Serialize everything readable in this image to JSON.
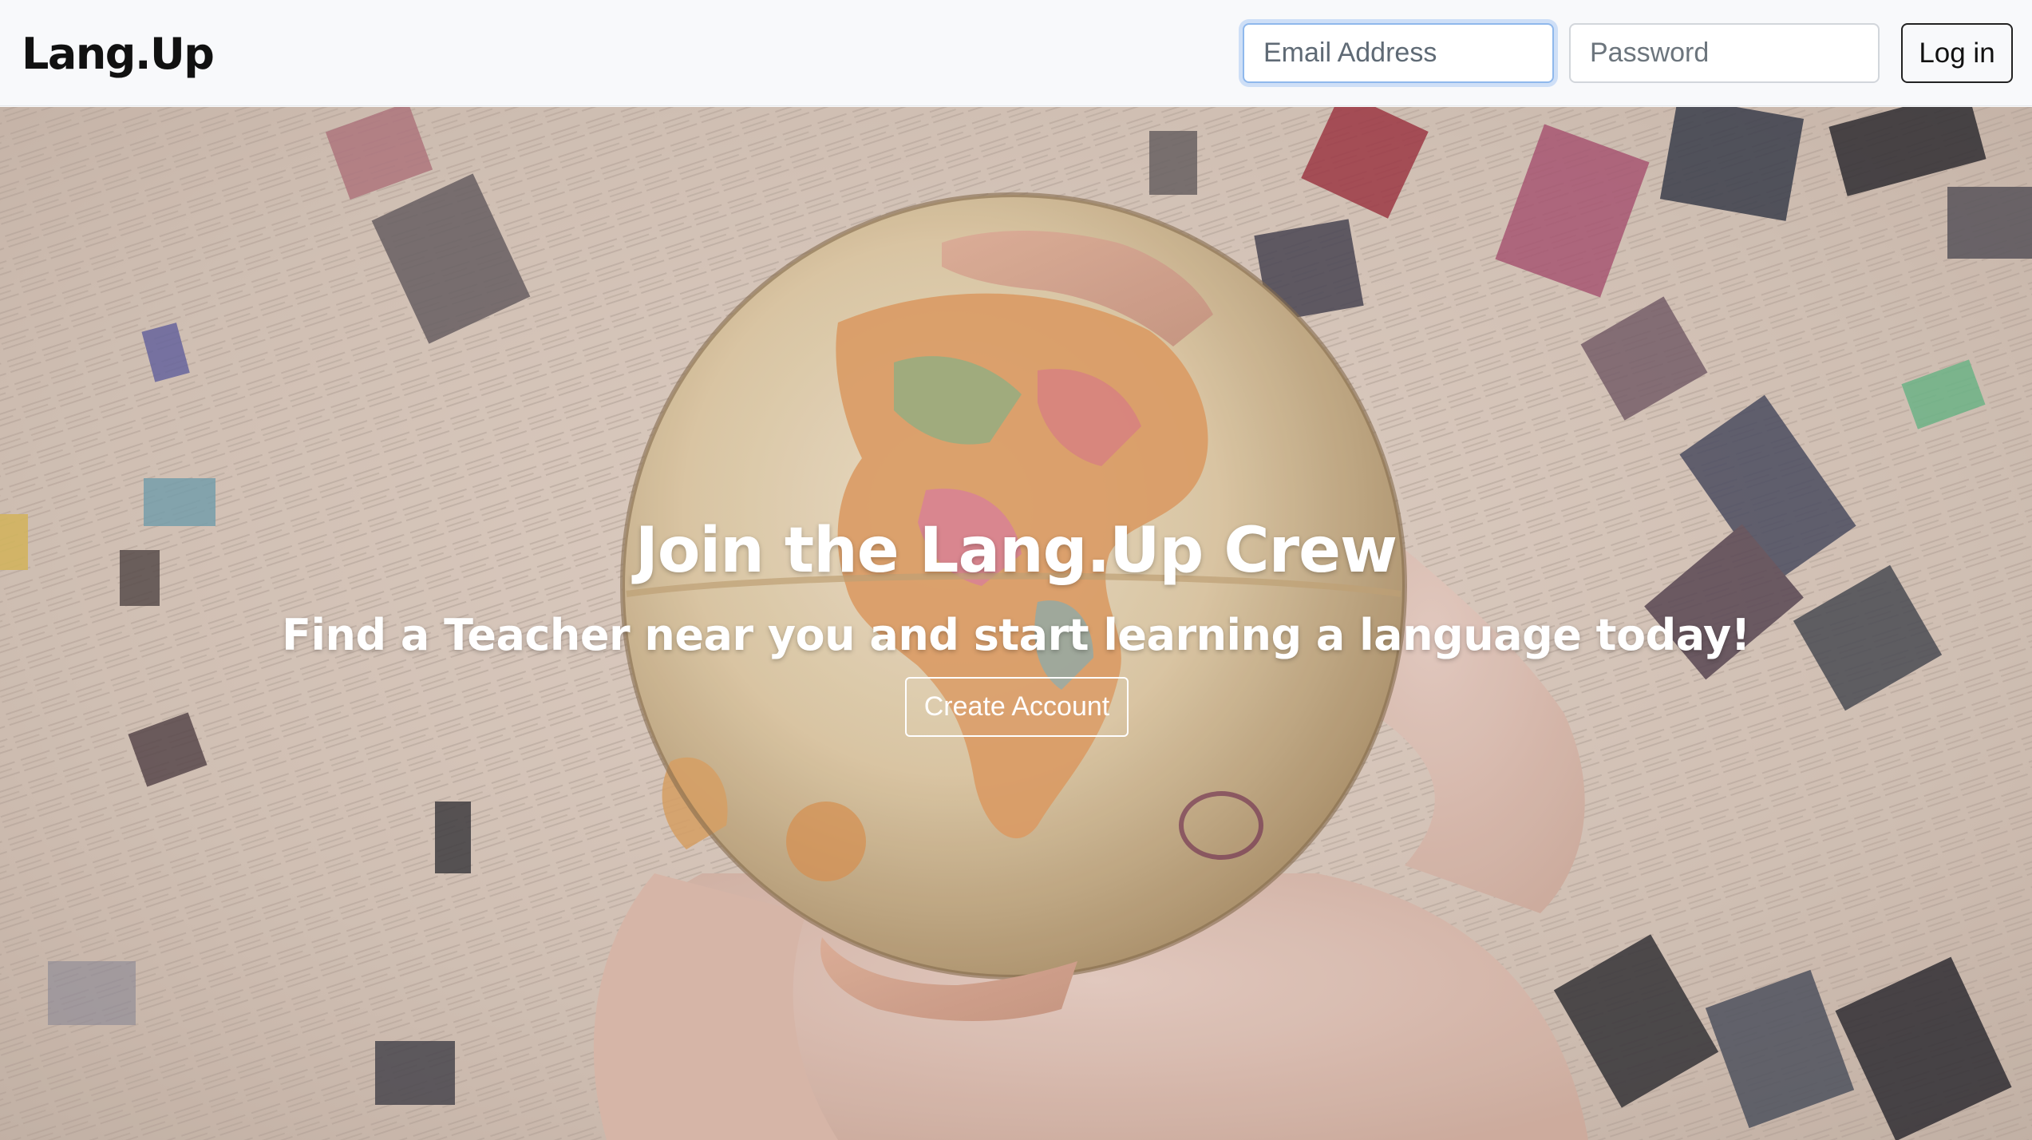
{
  "navbar": {
    "brand": "Lang.Up",
    "email_placeholder": "Email Address",
    "password_placeholder": "Password",
    "login_label": "Log in"
  },
  "hero": {
    "title": "Join the Lang.Up Crew",
    "subtitle": "Find a Teacher near you and start learning a language today!",
    "cta_label": "Create Account"
  },
  "colors": {
    "navbar_bg": "#f8f9fb",
    "focus_ring": "#8fb8ec",
    "hero_text": "#ffffff"
  }
}
